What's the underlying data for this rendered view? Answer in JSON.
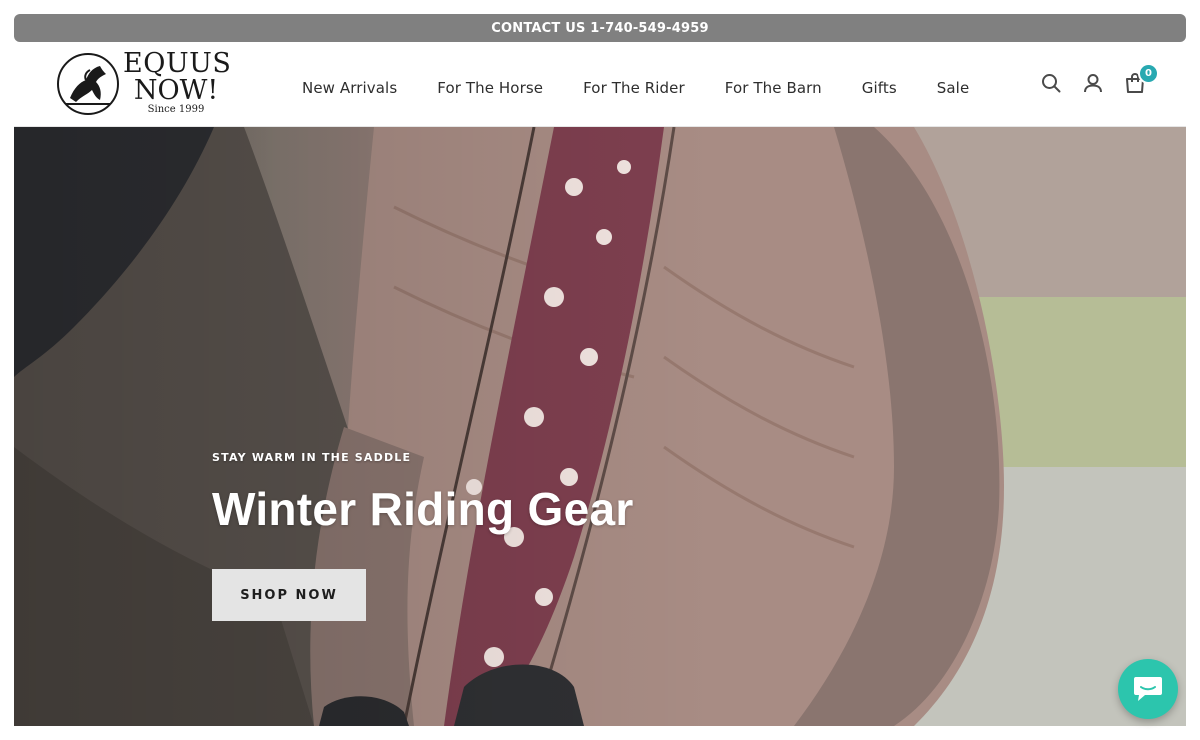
{
  "announcement": {
    "text": "CONTACT US 1-740-549-4959"
  },
  "logo": {
    "line1": "EQUUS",
    "line2": "NOW!",
    "line3": "Since 1999"
  },
  "nav": {
    "items": [
      {
        "label": "New Arrivals"
      },
      {
        "label": "For The Horse"
      },
      {
        "label": "For The Rider"
      },
      {
        "label": "For The Barn"
      },
      {
        "label": "Gifts"
      },
      {
        "label": "Sale"
      }
    ]
  },
  "header_icons": {
    "search": "search-icon",
    "account": "user-icon",
    "cart": "cart-icon",
    "cart_count": "0"
  },
  "hero": {
    "eyebrow": "STAY WARM IN THE SADDLE",
    "title": "Winter Riding Gear",
    "cta_label": "SHOP NOW"
  },
  "chat": {
    "icon": "chat-bubble-icon"
  },
  "colors": {
    "accent": "#28a9b1",
    "announcement_bg": "#808080",
    "chat": "#2cc5ad"
  }
}
